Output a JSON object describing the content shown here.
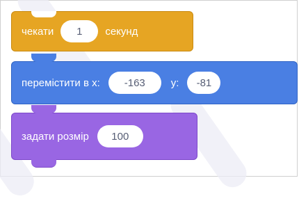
{
  "blocks": {
    "wait": {
      "before": "чекати",
      "value": "1",
      "after": "секунд",
      "color": "#e6a523"
    },
    "move": {
      "before": "перемістити в x:",
      "x_value": "-163",
      "y_label": "y:",
      "y_value": "-81",
      "color": "#4a7fe3"
    },
    "size": {
      "label": "задати розмір",
      "value": "100",
      "color": "#9966e3"
    }
  }
}
